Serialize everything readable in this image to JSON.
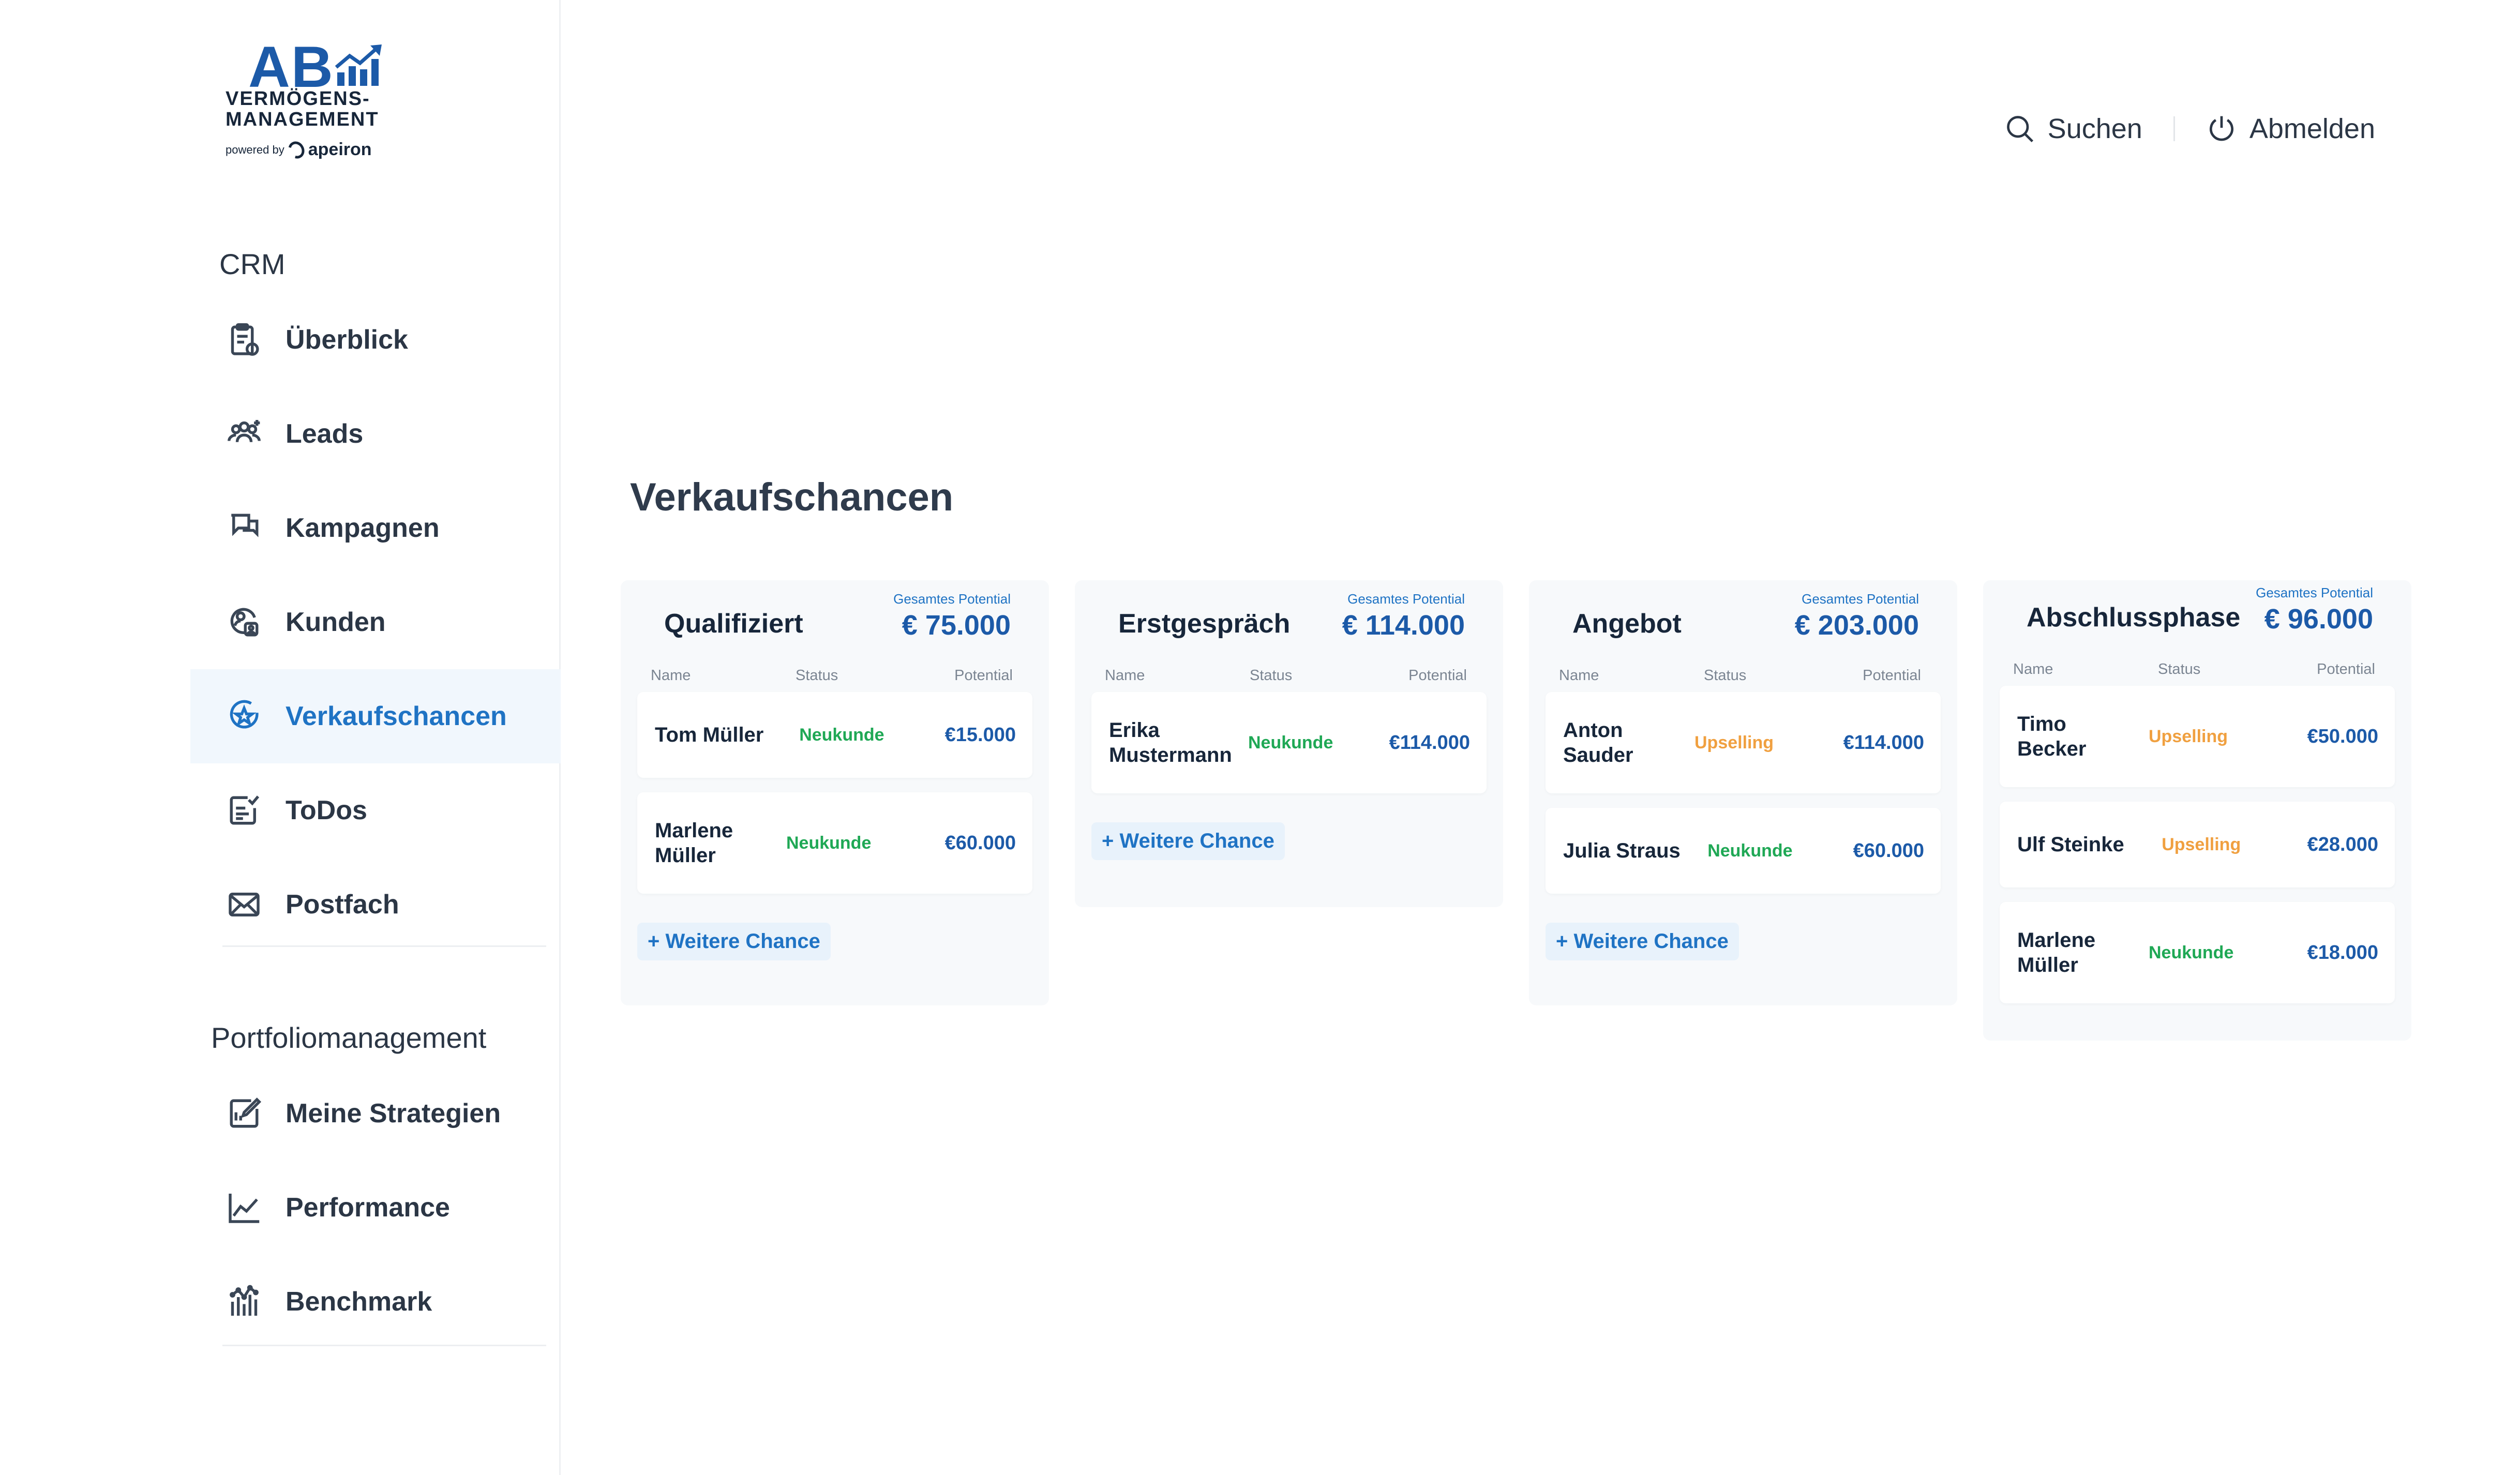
{
  "logo": {
    "mark": "AB",
    "line1": "VERMÖGENS-",
    "line2": "MANAGEMENT",
    "powered_by": "powered by",
    "brand": "apeiron"
  },
  "sidebar": {
    "sections": [
      {
        "title": "CRM",
        "items": [
          {
            "label": "Überblick",
            "icon": "clipboard-icon"
          },
          {
            "label": "Leads",
            "icon": "users-icon"
          },
          {
            "label": "Kampagnen",
            "icon": "chat-icon"
          },
          {
            "label": "Kunden",
            "icon": "user-search-icon"
          },
          {
            "label": "Verkaufschancen",
            "icon": "star-badge-icon",
            "active": true
          },
          {
            "label": "ToDos",
            "icon": "checklist-icon"
          },
          {
            "label": "Postfach",
            "icon": "mail-icon"
          }
        ]
      },
      {
        "title": "Portfoliomanagement",
        "items": [
          {
            "label": "Meine Strategien",
            "icon": "edit-icon"
          },
          {
            "label": "Performance",
            "icon": "line-chart-icon"
          },
          {
            "label": "Benchmark",
            "icon": "bar-chart-icon"
          }
        ]
      }
    ]
  },
  "topbar": {
    "search_label": "Suchen",
    "logout_label": "Abmelden"
  },
  "page_title": "Verkaufschancen",
  "columns_header": {
    "name": "Name",
    "status": "Status",
    "potential": "Potential",
    "total_caption": "Gesamtes Potential",
    "add_label": "+ Weitere Chance"
  },
  "colors": {
    "Neukunde": "#1fa855",
    "Upselling": "#f0a040",
    "accent": "#1f73c4"
  },
  "columns": [
    {
      "name": "Qualifiziert",
      "total": "€ 75.000",
      "cards": [
        {
          "name": "Tom Müller",
          "status": "Neukunde",
          "potential": "€15.000"
        },
        {
          "name": "Marlene Müller",
          "status": "Neukunde",
          "potential": "€60.000"
        }
      ],
      "show_add": true
    },
    {
      "name": "Erstgespräch",
      "total": "€ 114.000",
      "cards": [
        {
          "name": "Erika Mustermann",
          "status": "Neukunde",
          "potential": "€114.000"
        }
      ],
      "show_add": true
    },
    {
      "name": "Angebot",
      "total": "€ 203.000",
      "cards": [
        {
          "name": "Anton Sauder",
          "status": "Upselling",
          "potential": "€114.000"
        },
        {
          "name": "Julia Straus",
          "status": "Neukunde",
          "potential": "€60.000"
        }
      ],
      "show_add": true
    },
    {
      "name": "Abschlussphase",
      "total": "€ 96.000",
      "cards": [
        {
          "name": "Timo Becker",
          "status": "Upselling",
          "potential": "€50.000"
        },
        {
          "name": "Ulf Steinke",
          "status": "Upselling",
          "potential": "€28.000"
        },
        {
          "name": "Marlene Müller",
          "status": "Neukunde",
          "potential": "€18.000"
        }
      ],
      "show_add": false
    }
  ]
}
